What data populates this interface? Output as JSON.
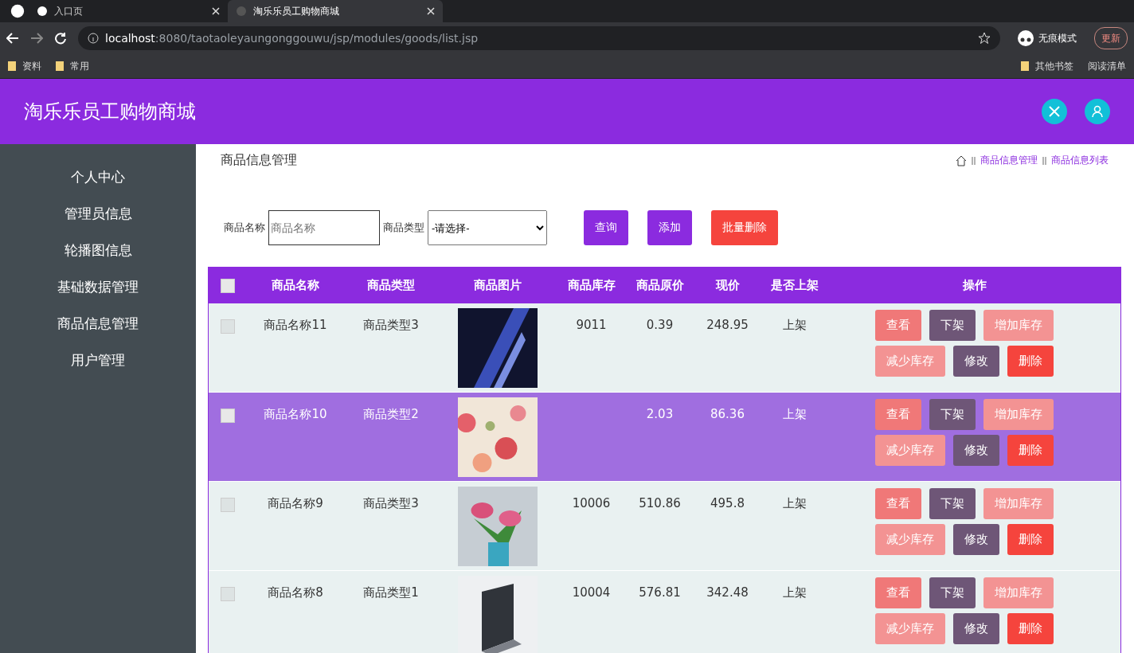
{
  "browser": {
    "tabs": [
      {
        "label": "入口页",
        "selected": false
      },
      {
        "label": "淘乐乐员工购物商城",
        "selected": true
      }
    ],
    "url_host": "localhost",
    "url_rest": ":8080/taotaoleyaungonggouwu/jsp/modules/goods/list.jsp",
    "incognito": "无痕模式",
    "update": "更新",
    "bookmarks": [
      "资料",
      "常用"
    ],
    "other_bookmarks": "其他书签",
    "reading_list": "阅读清单"
  },
  "header": {
    "title": "淘乐乐员工购物商城"
  },
  "sidebar": {
    "items": [
      {
        "label": "个人中心"
      },
      {
        "label": "管理员信息"
      },
      {
        "label": "轮播图信息"
      },
      {
        "label": "基础数据管理"
      },
      {
        "label": "商品信息管理"
      },
      {
        "label": "用户管理"
      }
    ]
  },
  "page": {
    "title": "商品信息管理",
    "breadcrumb": [
      "商品信息管理",
      "商品信息列表"
    ]
  },
  "search": {
    "name_label": "商品名称",
    "name_placeholder": "商品名称",
    "type_label": "商品类型",
    "type_value": "-请选择-",
    "buttons": [
      {
        "label": "查询",
        "kind": "primary"
      },
      {
        "label": "添加",
        "kind": "primary"
      },
      {
        "label": "批量删除",
        "kind": "danger"
      }
    ]
  },
  "table": {
    "all_checked": false,
    "columns": [
      "商品名称",
      "商品类型",
      "商品图片",
      "商品库存",
      "商品原价",
      "现价",
      "是否上架",
      "操作"
    ],
    "rows": [
      {
        "name": "商品名称11",
        "type": "商品类型3",
        "stock": "9011",
        "orig": "0.39",
        "price": "248.95",
        "status": "上架",
        "checked": false,
        "highlighted": false,
        "actions": [
          {
            "label": "查看",
            "kind": "view"
          },
          {
            "label": "下架",
            "kind": "dark"
          },
          {
            "label": "增加库存",
            "kind": "light"
          },
          {
            "label": "减少库存",
            "kind": "light"
          },
          {
            "label": "修改",
            "kind": "dark"
          },
          {
            "label": "删除",
            "kind": "danger"
          }
        ]
      },
      {
        "name": "商品名称10",
        "type": "商品类型2",
        "orig": "2.03",
        "price": "86.36",
        "status": "上架",
        "checked": false,
        "highlighted": true,
        "actions": [
          {
            "label": "查看",
            "kind": "view"
          },
          {
            "label": "下架",
            "kind": "dark"
          },
          {
            "label": "增加库存",
            "kind": "light"
          },
          {
            "label": "减少库存",
            "kind": "light"
          },
          {
            "label": "修改",
            "kind": "dark"
          },
          {
            "label": "删除",
            "kind": "danger"
          }
        ]
      },
      {
        "name": "商品名称9",
        "type": "商品类型3",
        "stock": "10006",
        "orig": "510.86",
        "price": "495.8",
        "status": "上架",
        "checked": false,
        "highlighted": false,
        "actions": [
          {
            "label": "查看",
            "kind": "view"
          },
          {
            "label": "下架",
            "kind": "dark"
          },
          {
            "label": "增加库存",
            "kind": "light"
          },
          {
            "label": "减少库存",
            "kind": "light"
          },
          {
            "label": "修改",
            "kind": "dark"
          },
          {
            "label": "删除",
            "kind": "danger"
          }
        ]
      },
      {
        "name": "商品名称8",
        "type": "商品类型1",
        "stock": "10004",
        "orig": "576.81",
        "price": "342.48",
        "status": "上架",
        "checked": false,
        "highlighted": false,
        "actions": [
          {
            "label": "查看",
            "kind": "view"
          },
          {
            "label": "下架",
            "kind": "dark"
          },
          {
            "label": "增加库存",
            "kind": "light"
          },
          {
            "label": "减少库存",
            "kind": "light"
          },
          {
            "label": "修改",
            "kind": "dark"
          },
          {
            "label": "删除",
            "kind": "danger"
          }
        ]
      }
    ]
  }
}
